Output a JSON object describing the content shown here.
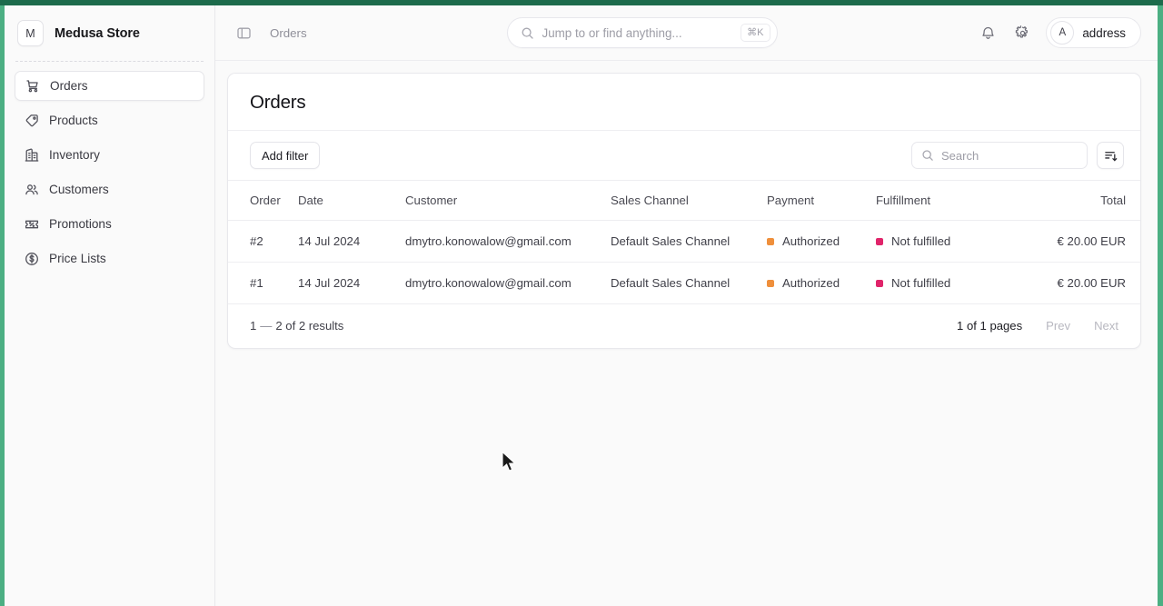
{
  "theme": {
    "frame_green": "#4caf83",
    "frame_green_dark": "#1d6b4c",
    "status_authorized": "#ef8f3b",
    "status_not_fulfilled": "#e0246a"
  },
  "sidebar": {
    "brand": {
      "initial": "M",
      "name": "Medusa Store"
    },
    "items": [
      {
        "label": "Orders",
        "icon": "cart-icon",
        "active": true
      },
      {
        "label": "Products",
        "icon": "tag-icon",
        "active": false
      },
      {
        "label": "Inventory",
        "icon": "building-icon",
        "active": false
      },
      {
        "label": "Customers",
        "icon": "users-icon",
        "active": false
      },
      {
        "label": "Promotions",
        "icon": "ticket-icon",
        "active": false
      },
      {
        "label": "Price Lists",
        "icon": "dollar-circle-icon",
        "active": false
      }
    ]
  },
  "topbar": {
    "panel_toggle_icon": "sidebar-toggle-icon",
    "breadcrumb": "Orders",
    "omnisearch": {
      "placeholder": "Jump to or find anything...",
      "shortcut": "⌘K",
      "icon": "search-icon"
    },
    "notifications_icon": "bell-icon",
    "settings_icon": "gear-icon",
    "user": {
      "initial": "A",
      "name": "address"
    }
  },
  "main": {
    "title": "Orders",
    "toolbar": {
      "add_filter_label": "Add filter",
      "search_placeholder": "Search",
      "sort_icon": "sort-descending-icon"
    },
    "table": {
      "columns": [
        "Order",
        "Date",
        "Customer",
        "Sales Channel",
        "Payment",
        "Fulfillment",
        "Total",
        ""
      ],
      "rows": [
        {
          "order": "#2",
          "date": "14 Jul 2024",
          "customer": "dmytro.konowalow@gmail.com",
          "sales_channel": "Default Sales Channel",
          "payment": "Authorized",
          "fulfillment": "Not fulfilled",
          "total": "€ 20.00 EUR",
          "extra": "-"
        },
        {
          "order": "#1",
          "date": "14 Jul 2024",
          "customer": "dmytro.konowalow@gmail.com",
          "sales_channel": "Default Sales Channel",
          "payment": "Authorized",
          "fulfillment": "Not fulfilled",
          "total": "€ 20.00 EUR",
          "extra": "-"
        }
      ]
    },
    "footer": {
      "range_start": "1",
      "range_dash": "—",
      "range_end": "2 of 2 results",
      "pages": "1 of 1 pages",
      "prev_label": "Prev",
      "next_label": "Next"
    }
  }
}
